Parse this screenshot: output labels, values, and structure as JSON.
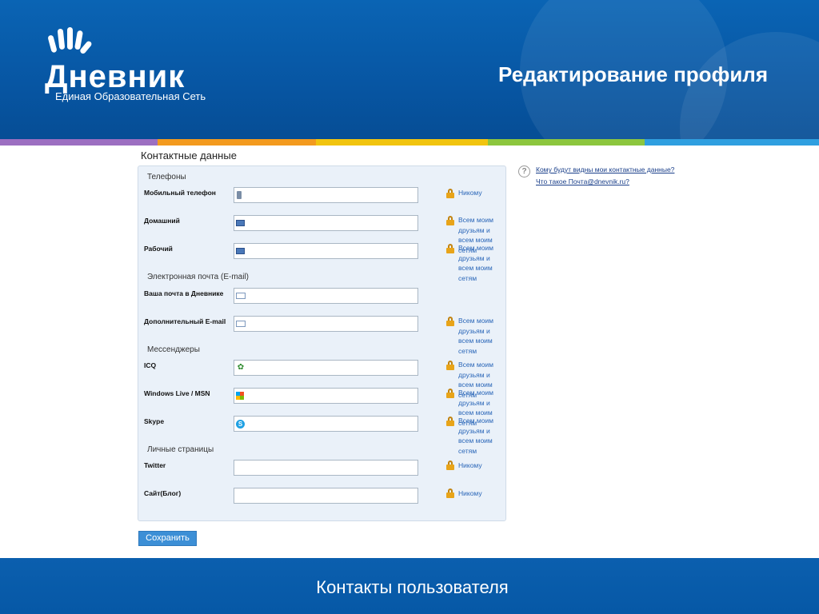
{
  "header": {
    "logo_text": "Дневник",
    "logo_subtitle": "Единая Образовательная Сеть",
    "page_title": "Редактирование профиля"
  },
  "colors": {
    "header_blue": "#0756a3",
    "panel_bg": "#eaf1f9",
    "link": "#2a66b8",
    "button": "#3c8fd6",
    "stripe": [
      "#9c6fc1",
      "#f39a1e",
      "#f1c40f",
      "#8cc63e",
      "#2f9fe0"
    ]
  },
  "form": {
    "section_title": "Контактные данные",
    "groups": {
      "phones": "Телефоны",
      "email": "Электронная почта (E-mail)",
      "messengers": "Мессенджеры",
      "pages": "Личные страницы"
    },
    "fields": [
      {
        "label": "Мобильный телефон",
        "icon": "mobile-phone-icon",
        "value": "",
        "privacy": "Никому"
      },
      {
        "label": "Домашний",
        "icon": "phone-icon",
        "value": "",
        "privacy": "Всем моим друзьям и всем моим сетям"
      },
      {
        "label": "Рабочий",
        "icon": "phone-icon",
        "value": "",
        "privacy": "Всем моим друзьям и всем моим сетям"
      },
      {
        "label": "Ваша почта в Дневнике",
        "icon": "envelope-icon",
        "value": "",
        "privacy": ""
      },
      {
        "label": "Дополнительный E-mail",
        "icon": "envelope-icon",
        "value": "",
        "privacy": "Всем моим друзьям и всем моим сетям"
      },
      {
        "label": "ICQ",
        "icon": "icq-icon",
        "value": "",
        "privacy": "Всем моим друзьям и всем моим сетям"
      },
      {
        "label": "Windows Live / MSN",
        "icon": "windows-icon",
        "value": "",
        "privacy": "Всем моим друзьям и всем моим сетям"
      },
      {
        "label": "Skype",
        "icon": "skype-icon",
        "value": "",
        "privacy": "Всем моим друзьям и всем моим сетям"
      },
      {
        "label": "Twitter",
        "icon": "",
        "value": "",
        "privacy": "Никому"
      },
      {
        "label": "Сайт(Блог)",
        "icon": "",
        "value": "",
        "privacy": "Никому"
      }
    ],
    "save_label": "Сохранить"
  },
  "help": {
    "link1": "Кому будут видны мои контактные данные?",
    "link2": "Что такое Почта@dnevnik.ru?"
  },
  "footer": {
    "caption": "Контакты пользователя"
  }
}
